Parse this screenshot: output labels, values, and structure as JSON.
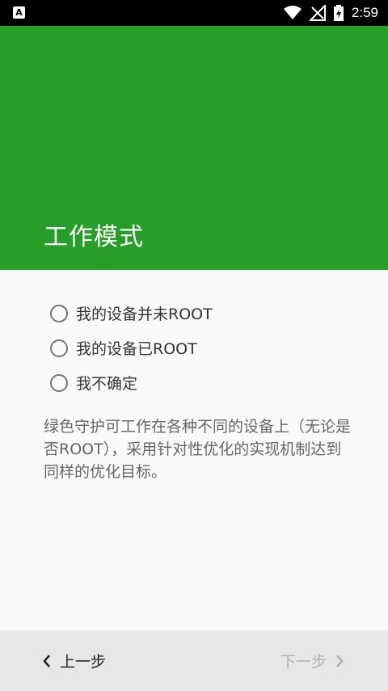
{
  "status_bar": {
    "left_icon": "A",
    "time": "2:59",
    "icons": [
      "wifi-icon",
      "signal-off-icon",
      "battery-charging-icon"
    ]
  },
  "header": {
    "title": "工作模式",
    "background_color": "#279e27"
  },
  "options": [
    {
      "label": "我的设备并未ROOT",
      "selected": false
    },
    {
      "label": "我的设备已ROOT",
      "selected": false
    },
    {
      "label": "我不确定",
      "selected": false
    }
  ],
  "description": "绿色守护可工作在各种不同的设备上（无论是否ROOT），采用针对性优化的实现机制达到同样的优化目标。",
  "bottom_bar": {
    "back_label": "上一步",
    "next_label": "下一步"
  }
}
